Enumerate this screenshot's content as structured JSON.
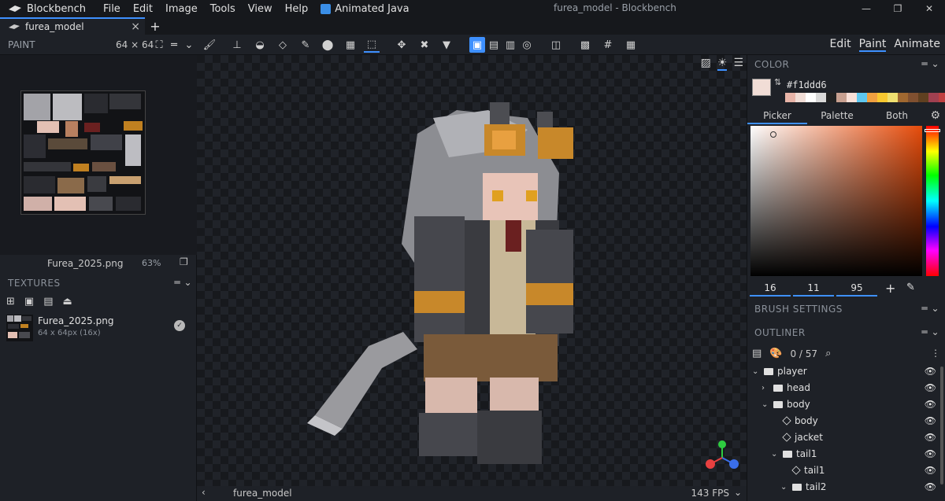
{
  "app": {
    "name": "Blockbench",
    "window_title": "furea_model - Blockbench",
    "menu": [
      "File",
      "Edit",
      "Image",
      "Tools",
      "View",
      "Help"
    ],
    "plugin_menu": "Animated Java",
    "window_controls": [
      "—",
      "❐",
      "✕"
    ]
  },
  "tabs": [
    {
      "label": "furea_model",
      "close": "×"
    }
  ],
  "tab_add": "+",
  "toolbar": {
    "panel_label": "PAINT",
    "canvas_size": "64 × 64",
    "modes": [
      "Edit",
      "Paint",
      "Animate"
    ],
    "active_mode": "Paint"
  },
  "texture_view": {
    "filename": "Furea_2025.png",
    "zoom": "63%"
  },
  "textures_panel": {
    "title": "TEXTURES",
    "items": [
      {
        "name": "Furea_2025.png",
        "info": "64 x 64px (16x)"
      }
    ]
  },
  "viewport": {
    "model_name": "furea_model",
    "fps": "143 FPS"
  },
  "color_panel": {
    "title": "COLOR",
    "hex": "#f1ddd6",
    "main_color": "#f1ddd6",
    "palette": [
      "#e8b4a8",
      "#f1ddd6",
      "#ffffff",
      "#d9d9d9",
      "#222222",
      "#c8a090",
      "#f9e0d8",
      "#5fc8f0",
      "#f0a040",
      "#f8c830",
      "#f0e070",
      "#a06830",
      "#805030",
      "#604020",
      "#a04050",
      "#c04040",
      "#d07030"
    ],
    "tabs": [
      "Picker",
      "Palette",
      "Both"
    ],
    "active_tab": "Picker",
    "hsv": [
      "16",
      "11",
      "95"
    ]
  },
  "brush_settings": {
    "title": "BRUSH SETTINGS"
  },
  "outliner": {
    "title": "OUTLINER",
    "count": "0 / 57",
    "nodes": [
      {
        "label": "player",
        "type": "folder",
        "depth": 0,
        "expanded": true
      },
      {
        "label": "head",
        "type": "folder",
        "depth": 1,
        "expanded": false
      },
      {
        "label": "body",
        "type": "folder",
        "depth": 1,
        "expanded": true
      },
      {
        "label": "body",
        "type": "cube",
        "depth": 2
      },
      {
        "label": "jacket",
        "type": "cube",
        "depth": 2
      },
      {
        "label": "tail1",
        "type": "folder",
        "depth": 2,
        "expanded": true
      },
      {
        "label": "tail1",
        "type": "cube",
        "depth": 3
      },
      {
        "label": "tail2",
        "type": "folder",
        "depth": 3,
        "expanded": true
      }
    ]
  }
}
